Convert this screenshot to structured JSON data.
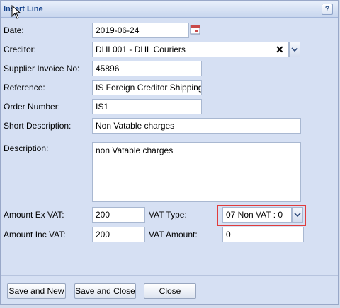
{
  "dialog": {
    "title": "Insert Line",
    "help_label": "?"
  },
  "form": {
    "date": {
      "label": "Date:",
      "value": "2019-06-24"
    },
    "creditor": {
      "label": "Creditor:",
      "value": "DHL001 - DHL Couriers"
    },
    "supplier_invoice": {
      "label": "Supplier Invoice No:",
      "value": "45896"
    },
    "reference": {
      "label": "Reference:",
      "value": "IS Foreign Creditor Shipping"
    },
    "order_number": {
      "label": "Order Number:",
      "value": "IS1"
    },
    "short_description": {
      "label": "Short Description:",
      "value": "Non Vatable charges"
    },
    "description": {
      "label": "Description:",
      "value": "non Vatable charges"
    },
    "amount_ex_vat": {
      "label": "Amount Ex VAT:",
      "value": "200"
    },
    "amount_inc_vat": {
      "label": "Amount Inc VAT:",
      "value": "200"
    },
    "vat_type": {
      "label": "VAT Type:",
      "value": "07 Non VAT : 0"
    },
    "vat_amount": {
      "label": "VAT Amount:",
      "value": "0"
    }
  },
  "buttons": {
    "save_and_new": "Save and New",
    "save_and_close": "Save and Close",
    "close": "Close"
  },
  "icons": {
    "date_trigger": "calendar-icon",
    "creditor_clear": "close-icon",
    "combo_arrow": "chevron-down-icon",
    "help": "help-icon"
  },
  "colors": {
    "highlight": "#e03c3c",
    "title_text": "#15428b",
    "dialog_bg": "#d6e0f3"
  }
}
